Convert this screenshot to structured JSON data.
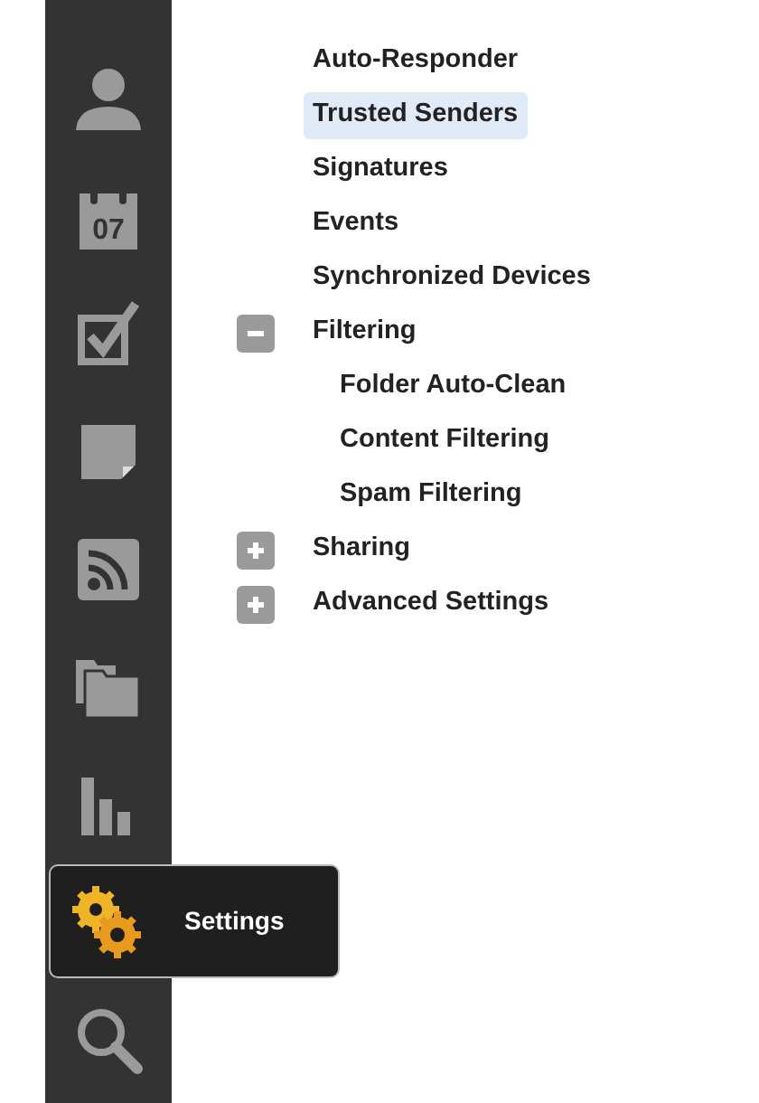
{
  "sidebar": {
    "items": [
      {
        "kind": "contacts",
        "selected": false
      },
      {
        "kind": "calendar",
        "selected": false,
        "day": "07"
      },
      {
        "kind": "tasks",
        "selected": false
      },
      {
        "kind": "notes",
        "selected": false
      },
      {
        "kind": "feeds",
        "selected": false
      },
      {
        "kind": "files",
        "selected": false
      },
      {
        "kind": "reports",
        "selected": false
      },
      {
        "kind": "settings",
        "selected": true,
        "label": "Settings"
      },
      {
        "kind": "search",
        "selected": false
      }
    ]
  },
  "tree": {
    "items": [
      {
        "label": "Auto-Responder",
        "selected": false
      },
      {
        "label": "Trusted Senders",
        "selected": true
      },
      {
        "label": "Signatures",
        "selected": false
      },
      {
        "label": "Events",
        "selected": false
      },
      {
        "label": "Synchronized Devices",
        "selected": false
      },
      {
        "label": "Filtering",
        "selected": false,
        "expanded": true,
        "children": [
          {
            "label": "Folder Auto-Clean",
            "selected": false
          },
          {
            "label": "Content Filtering",
            "selected": false
          },
          {
            "label": "Spam Filtering",
            "selected": false
          }
        ]
      },
      {
        "label": "Sharing",
        "selected": false,
        "expanded": false
      },
      {
        "label": "Advanced Settings",
        "selected": false,
        "expanded": false
      }
    ]
  }
}
